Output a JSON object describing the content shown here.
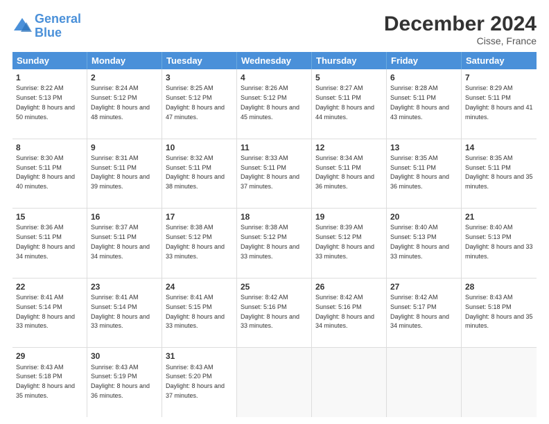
{
  "header": {
    "logo_line1": "General",
    "logo_line2": "Blue",
    "month_title": "December 2024",
    "location": "Cisse, France"
  },
  "days_of_week": [
    "Sunday",
    "Monday",
    "Tuesday",
    "Wednesday",
    "Thursday",
    "Friday",
    "Saturday"
  ],
  "weeks": [
    [
      {
        "day": "1",
        "sunrise": "Sunrise: 8:22 AM",
        "sunset": "Sunset: 5:13 PM",
        "daylight": "Daylight: 8 hours and 50 minutes."
      },
      {
        "day": "2",
        "sunrise": "Sunrise: 8:24 AM",
        "sunset": "Sunset: 5:12 PM",
        "daylight": "Daylight: 8 hours and 48 minutes."
      },
      {
        "day": "3",
        "sunrise": "Sunrise: 8:25 AM",
        "sunset": "Sunset: 5:12 PM",
        "daylight": "Daylight: 8 hours and 47 minutes."
      },
      {
        "day": "4",
        "sunrise": "Sunrise: 8:26 AM",
        "sunset": "Sunset: 5:12 PM",
        "daylight": "Daylight: 8 hours and 45 minutes."
      },
      {
        "day": "5",
        "sunrise": "Sunrise: 8:27 AM",
        "sunset": "Sunset: 5:11 PM",
        "daylight": "Daylight: 8 hours and 44 minutes."
      },
      {
        "day": "6",
        "sunrise": "Sunrise: 8:28 AM",
        "sunset": "Sunset: 5:11 PM",
        "daylight": "Daylight: 8 hours and 43 minutes."
      },
      {
        "day": "7",
        "sunrise": "Sunrise: 8:29 AM",
        "sunset": "Sunset: 5:11 PM",
        "daylight": "Daylight: 8 hours and 41 minutes."
      }
    ],
    [
      {
        "day": "8",
        "sunrise": "Sunrise: 8:30 AM",
        "sunset": "Sunset: 5:11 PM",
        "daylight": "Daylight: 8 hours and 40 minutes."
      },
      {
        "day": "9",
        "sunrise": "Sunrise: 8:31 AM",
        "sunset": "Sunset: 5:11 PM",
        "daylight": "Daylight: 8 hours and 39 minutes."
      },
      {
        "day": "10",
        "sunrise": "Sunrise: 8:32 AM",
        "sunset": "Sunset: 5:11 PM",
        "daylight": "Daylight: 8 hours and 38 minutes."
      },
      {
        "day": "11",
        "sunrise": "Sunrise: 8:33 AM",
        "sunset": "Sunset: 5:11 PM",
        "daylight": "Daylight: 8 hours and 37 minutes."
      },
      {
        "day": "12",
        "sunrise": "Sunrise: 8:34 AM",
        "sunset": "Sunset: 5:11 PM",
        "daylight": "Daylight: 8 hours and 36 minutes."
      },
      {
        "day": "13",
        "sunrise": "Sunrise: 8:35 AM",
        "sunset": "Sunset: 5:11 PM",
        "daylight": "Daylight: 8 hours and 36 minutes."
      },
      {
        "day": "14",
        "sunrise": "Sunrise: 8:35 AM",
        "sunset": "Sunset: 5:11 PM",
        "daylight": "Daylight: 8 hours and 35 minutes."
      }
    ],
    [
      {
        "day": "15",
        "sunrise": "Sunrise: 8:36 AM",
        "sunset": "Sunset: 5:11 PM",
        "daylight": "Daylight: 8 hours and 34 minutes."
      },
      {
        "day": "16",
        "sunrise": "Sunrise: 8:37 AM",
        "sunset": "Sunset: 5:11 PM",
        "daylight": "Daylight: 8 hours and 34 minutes."
      },
      {
        "day": "17",
        "sunrise": "Sunrise: 8:38 AM",
        "sunset": "Sunset: 5:12 PM",
        "daylight": "Daylight: 8 hours and 33 minutes."
      },
      {
        "day": "18",
        "sunrise": "Sunrise: 8:38 AM",
        "sunset": "Sunset: 5:12 PM",
        "daylight": "Daylight: 8 hours and 33 minutes."
      },
      {
        "day": "19",
        "sunrise": "Sunrise: 8:39 AM",
        "sunset": "Sunset: 5:12 PM",
        "daylight": "Daylight: 8 hours and 33 minutes."
      },
      {
        "day": "20",
        "sunrise": "Sunrise: 8:40 AM",
        "sunset": "Sunset: 5:13 PM",
        "daylight": "Daylight: 8 hours and 33 minutes."
      },
      {
        "day": "21",
        "sunrise": "Sunrise: 8:40 AM",
        "sunset": "Sunset: 5:13 PM",
        "daylight": "Daylight: 8 hours and 33 minutes."
      }
    ],
    [
      {
        "day": "22",
        "sunrise": "Sunrise: 8:41 AM",
        "sunset": "Sunset: 5:14 PM",
        "daylight": "Daylight: 8 hours and 33 minutes."
      },
      {
        "day": "23",
        "sunrise": "Sunrise: 8:41 AM",
        "sunset": "Sunset: 5:14 PM",
        "daylight": "Daylight: 8 hours and 33 minutes."
      },
      {
        "day": "24",
        "sunrise": "Sunrise: 8:41 AM",
        "sunset": "Sunset: 5:15 PM",
        "daylight": "Daylight: 8 hours and 33 minutes."
      },
      {
        "day": "25",
        "sunrise": "Sunrise: 8:42 AM",
        "sunset": "Sunset: 5:16 PM",
        "daylight": "Daylight: 8 hours and 33 minutes."
      },
      {
        "day": "26",
        "sunrise": "Sunrise: 8:42 AM",
        "sunset": "Sunset: 5:16 PM",
        "daylight": "Daylight: 8 hours and 34 minutes."
      },
      {
        "day": "27",
        "sunrise": "Sunrise: 8:42 AM",
        "sunset": "Sunset: 5:17 PM",
        "daylight": "Daylight: 8 hours and 34 minutes."
      },
      {
        "day": "28",
        "sunrise": "Sunrise: 8:43 AM",
        "sunset": "Sunset: 5:18 PM",
        "daylight": "Daylight: 8 hours and 35 minutes."
      }
    ],
    [
      {
        "day": "29",
        "sunrise": "Sunrise: 8:43 AM",
        "sunset": "Sunset: 5:18 PM",
        "daylight": "Daylight: 8 hours and 35 minutes."
      },
      {
        "day": "30",
        "sunrise": "Sunrise: 8:43 AM",
        "sunset": "Sunset: 5:19 PM",
        "daylight": "Daylight: 8 hours and 36 minutes."
      },
      {
        "day": "31",
        "sunrise": "Sunrise: 8:43 AM",
        "sunset": "Sunset: 5:20 PM",
        "daylight": "Daylight: 8 hours and 37 minutes."
      },
      {
        "day": "",
        "sunrise": "",
        "sunset": "",
        "daylight": ""
      },
      {
        "day": "",
        "sunrise": "",
        "sunset": "",
        "daylight": ""
      },
      {
        "day": "",
        "sunrise": "",
        "sunset": "",
        "daylight": ""
      },
      {
        "day": "",
        "sunrise": "",
        "sunset": "",
        "daylight": ""
      }
    ]
  ]
}
